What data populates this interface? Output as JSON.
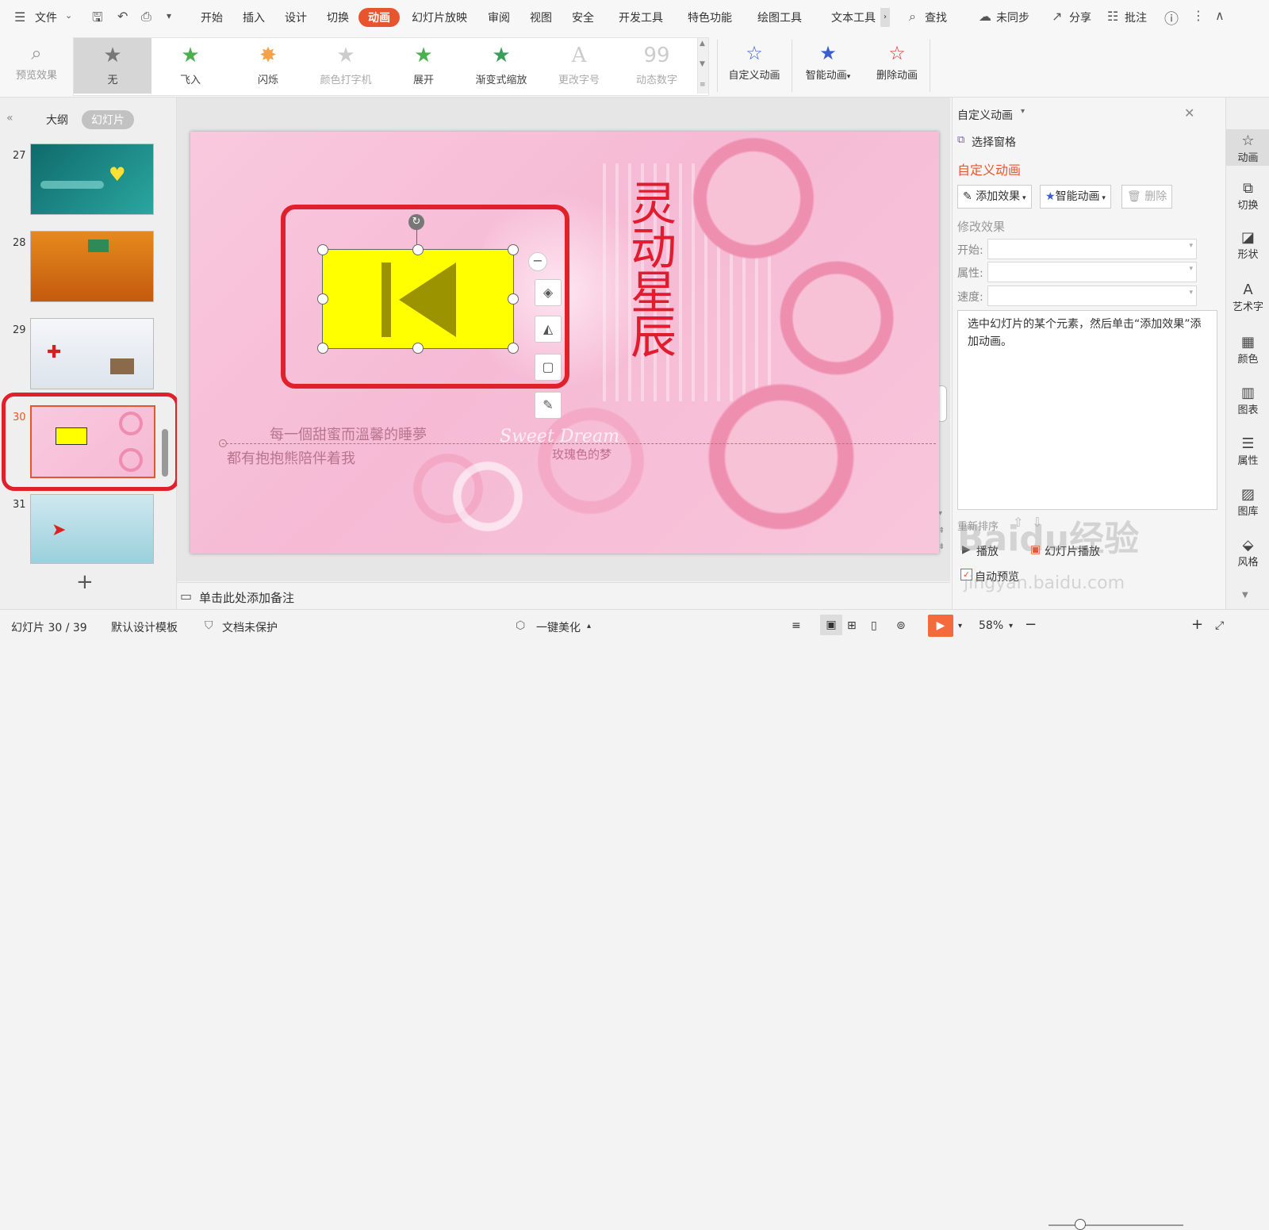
{
  "menu": {
    "file_label": "文件",
    "tabs": [
      "开始",
      "插入",
      "设计",
      "切换",
      "动画",
      "幻灯片放映",
      "审阅",
      "视图",
      "安全",
      "开发工具",
      "特色功能",
      "绘图工具",
      "文本工具"
    ],
    "active_tab": "动画",
    "search_label": "查找",
    "sync_label": "未同步",
    "share_label": "分享",
    "comment_label": "批注"
  },
  "ribbon": {
    "preview_label": "预览效果",
    "effects": [
      {
        "label": "无",
        "icon": "star-icon"
      },
      {
        "label": "飞入",
        "icon": "fly-in-star-icon"
      },
      {
        "label": "闪烁",
        "icon": "flash-star-icon"
      },
      {
        "label": "颜色打字机",
        "icon": "typewriter-star-icon"
      },
      {
        "label": "展开",
        "icon": "expand-star-icon"
      },
      {
        "label": "渐变式缩放",
        "icon": "zoom-star-icon"
      },
      {
        "label": "更改字号",
        "icon": "font-size-icon"
      },
      {
        "label": "动态数字",
        "icon": "dynamic-number-icon"
      }
    ],
    "custom_anim_label": "自定义动画",
    "smart_anim_label": "智能动画",
    "delete_anim_label": "删除动画"
  },
  "left_panel": {
    "outline_tab": "大纲",
    "slides_tab": "幻灯片",
    "slide_numbers": [
      "27",
      "28",
      "29",
      "30",
      "31"
    ],
    "current_slide": "30"
  },
  "slide": {
    "title_vertical": "灵动星辰",
    "caption_line1": "每一個甜蜜而溫馨的睡夢",
    "caption_line2": "都有抱抱熊陪伴着我",
    "sweet_dream": "Sweet Dream",
    "rose_dream": "玫瑰色的梦"
  },
  "notes_placeholder": "单击此处添加备注",
  "right_panel": {
    "header": "自定义动画",
    "select_pane": "选择窗格",
    "section_title": "自定义动画",
    "add_effect": "添加效果",
    "smart_anim": "智能动画",
    "delete": "删除",
    "modify_title": "修改效果",
    "start_label": "开始:",
    "property_label": "属性:",
    "speed_label": "速度:",
    "hint": "选中幻灯片的某个元素，然后单击“添加效果”添加动画。",
    "reorder_label": "重新排序",
    "play_label": "播放",
    "slideshow_label": "幻灯片播放",
    "auto_preview": "自动预览"
  },
  "far_right": [
    "动画",
    "切换",
    "形状",
    "艺术字",
    "颜色",
    "图表",
    "属性",
    "图库",
    "风格"
  ],
  "status": {
    "slide_info": "幻灯片 30 / 39",
    "template": "默认设计模板",
    "protection": "文档未保护",
    "beautify": "一键美化",
    "zoom": "58%"
  },
  "watermark": {
    "brand": "Baidu经验",
    "url": "jingyan.baidu.com"
  },
  "colors": {
    "accent": "#e8552d",
    "highlight_border": "#e0202a",
    "button_fill": "#ffff00",
    "button_glyph": "#9b9300"
  }
}
